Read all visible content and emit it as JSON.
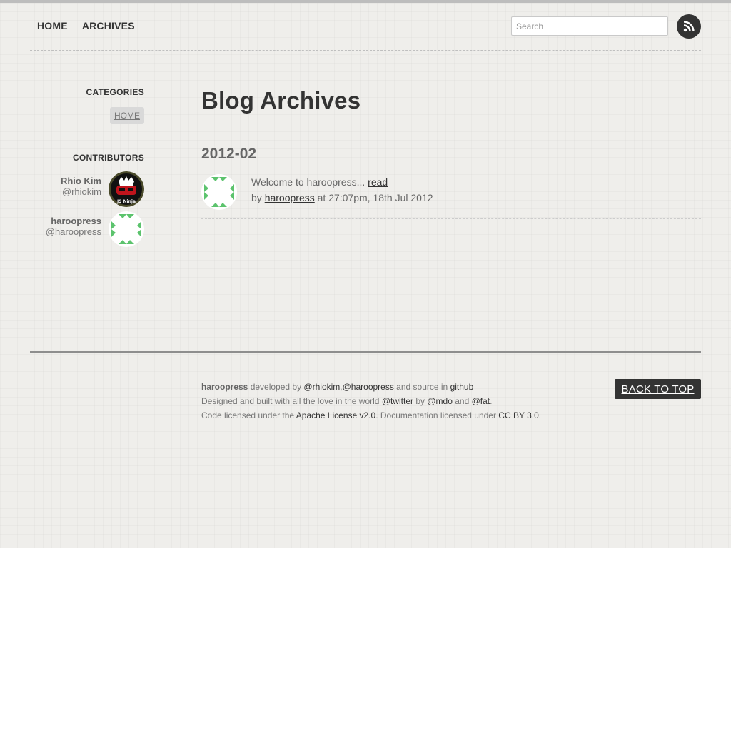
{
  "nav": {
    "items": [
      {
        "label": "HOME"
      },
      {
        "label": "ARCHIVES"
      }
    ],
    "search_placeholder": "Search",
    "rss_icon": "rss-icon"
  },
  "sidebar": {
    "categories_heading": "CATEGORIES",
    "categories": [
      {
        "label": "HOME"
      }
    ],
    "contributors_heading": "CONTRIBUTORS",
    "contributors": [
      {
        "name": "Rhio Kim",
        "handle": "@rhiokim",
        "avatar": "js-ninja-avatar"
      },
      {
        "name": "haroopress",
        "handle": "@haroopress",
        "avatar": "identicon-avatar"
      }
    ]
  },
  "main": {
    "title": "Blog Archives",
    "groups": [
      {
        "year": "2012-02",
        "posts": [
          {
            "excerpt": "Welcome to haroopress...",
            "read_label": "read",
            "by": "by",
            "author": "haroopress",
            "meta": "at 27:07pm, 18th Jul 2012"
          }
        ]
      }
    ]
  },
  "footer": {
    "line1": {
      "brand": "haroopress",
      "t1": " developed by ",
      "l1": "@rhiokim",
      "sep": ",",
      "l2": "@haroopress",
      "t2": " and source in ",
      "l3": "github"
    },
    "line2": {
      "t1": "Designed and built with all the love in the world ",
      "l1": "@twitter",
      "t2": " by ",
      "l2": "@mdo",
      "t3": " and ",
      "l3": "@fat",
      "t4": "."
    },
    "line3": {
      "t1": "Code licensed under the ",
      "l1": "Apache License v2.0",
      "t2": ". Documentation licensed under ",
      "l2": "CC BY 3.0",
      "t3": "."
    },
    "back_to_top": "BACK TO TOP"
  }
}
